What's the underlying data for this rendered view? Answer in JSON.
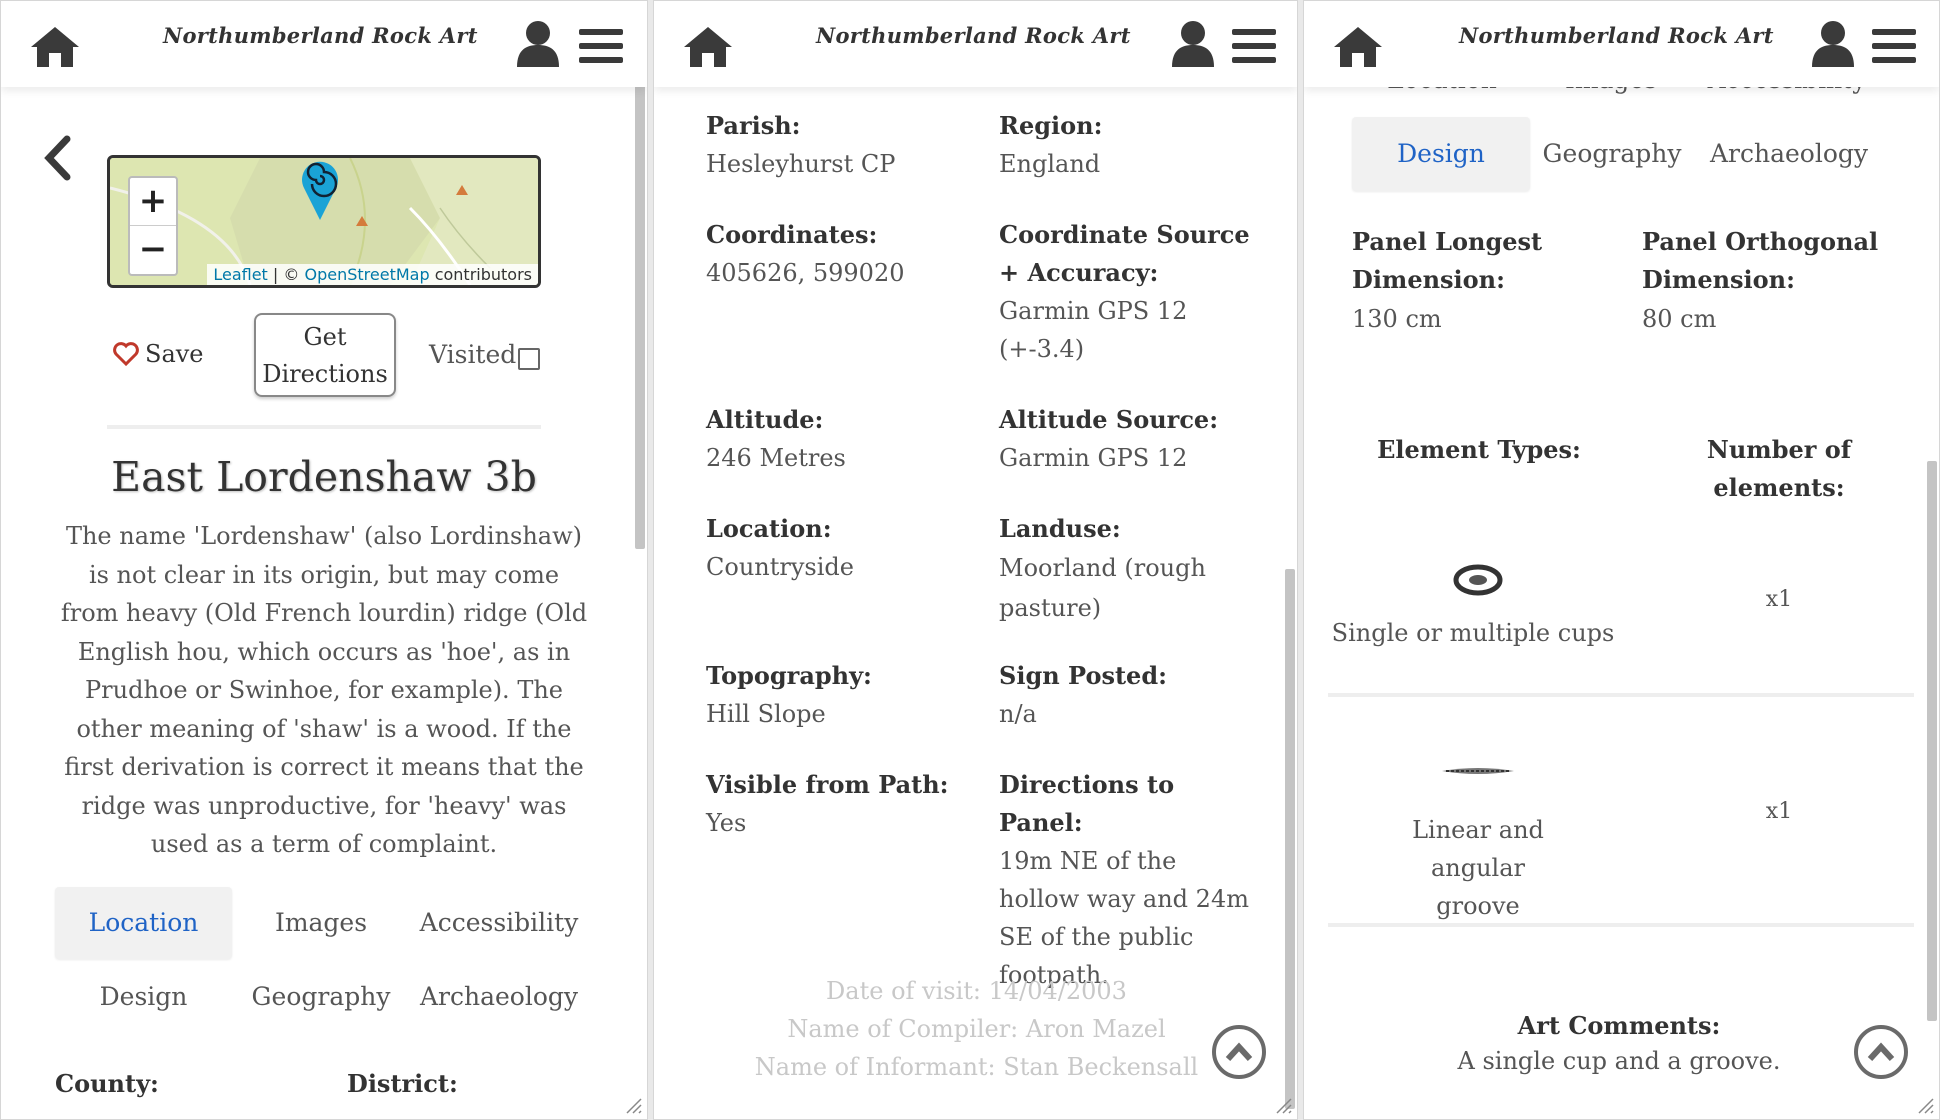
{
  "app_title": "Northumberland Rock Art",
  "panel1": {
    "map": {
      "zoom_in": "+",
      "zoom_out": "−",
      "attribution_leaflet": "Leaflet",
      "attribution_sep": " | © ",
      "attribution_osm": "OpenStreetMap",
      "attribution_tail": " contributors"
    },
    "save_label": "Save",
    "directions_label": "Get Directions",
    "visited_label": "Visited",
    "site_title": "East Lordenshaw 3b",
    "description": "The name 'Lordenshaw' (also Lordinshaw) is not clear in its origin, but may come from heavy (Old French lourdin) ridge (Old English hou, which occurs as 'hoe', as in Prudhoe or Swinhoe, for example). The other meaning of 'shaw' is a wood. If the first derivation is correct it means that the ridge was unproductive, for 'heavy' was used as a term of complaint.",
    "tabs": [
      "Location",
      "Images",
      "Accessibility",
      "Design",
      "Geography",
      "Archaeology"
    ],
    "county_label": "County:",
    "district_label": "District:"
  },
  "panel2": {
    "fields": [
      {
        "label": "Parish:",
        "value": "Hesleyhurst CP"
      },
      {
        "label": "Region:",
        "value": "England"
      },
      {
        "label": "Coordinates:",
        "value": "405626, 599020"
      },
      {
        "label": "Coordinate Source + Accuracy:",
        "value": "Garmin GPS 12 (+-3.4)"
      },
      {
        "label": "Altitude:",
        "value": "246 Metres"
      },
      {
        "label": "Altitude Source:",
        "value": "Garmin GPS 12"
      },
      {
        "label": "Location:",
        "value": "Countryside"
      },
      {
        "label": "Landuse:",
        "value": "Moorland (rough pasture)"
      },
      {
        "label": "Topography:",
        "value": "Hill Slope"
      },
      {
        "label": "Sign Posted:",
        "value": "n/a"
      },
      {
        "label": "Visible from Path:",
        "value": "Yes"
      },
      {
        "label": "Directions to Panel:",
        "value": "19m NE of the hollow way and 24m SE of the public footpath."
      }
    ],
    "date_of_visit": "Date of visit: 14/04/2003",
    "compiler": "Name of Compiler: Aron Mazel",
    "informant": "Name of Informant: Stan Beckensall"
  },
  "panel3": {
    "tabs_top_partial": [
      "Location",
      "Images",
      "Accessibility"
    ],
    "tabs": [
      "Design",
      "Geography",
      "Archaeology"
    ],
    "longest_label": "Panel Longest Dimension:",
    "longest_value": "130 cm",
    "orthogonal_label": "Panel Orthogonal Dimension:",
    "orthogonal_value": "80 cm",
    "element_types_header": "Element Types:",
    "number_header": "Number of elements:",
    "elements": [
      {
        "name": "Single or multiple cups",
        "count": "x1"
      },
      {
        "name": "Linear and angular groove",
        "count": "x1"
      }
    ],
    "art_comments_label": "Art Comments:",
    "art_comments_value": "A single cup and a groove."
  },
  "colors": {
    "active_tab": "#1f63c6",
    "heart": "#c0392b",
    "map_marker": "#1aa3d6"
  }
}
